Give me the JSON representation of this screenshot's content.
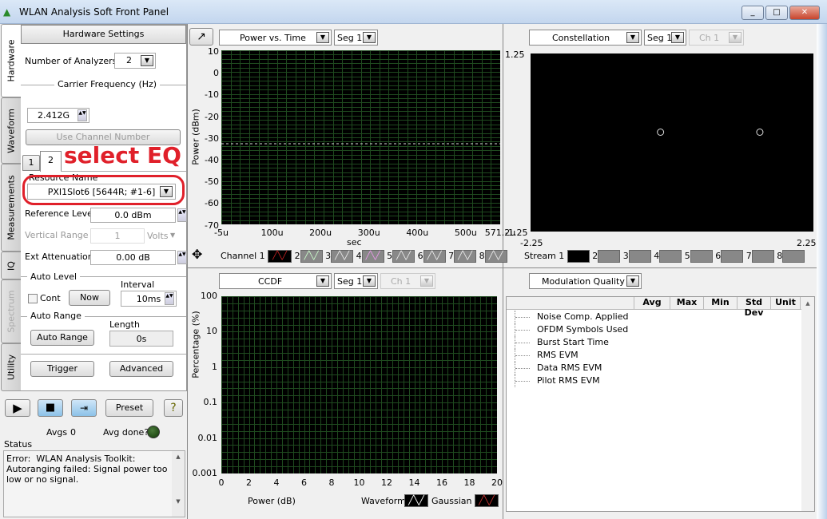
{
  "window": {
    "title": "WLAN Analysis Soft Front Panel",
    "buttons": [
      "_",
      "□",
      "✕"
    ]
  },
  "tabs": [
    {
      "label": "Hardware",
      "selected": true
    },
    {
      "label": "Waveform"
    },
    {
      "label": "Measurements"
    },
    {
      "label": "IQ"
    },
    {
      "label": "Spectrum",
      "disabled": true
    },
    {
      "label": "Utility"
    }
  ],
  "hardware": {
    "header": "Hardware Settings",
    "num_analyzers_label": "Number of Analyzers",
    "num_analyzers": "2",
    "carrier_label": "Carrier Frequency (Hz)",
    "carrier": "2.412G",
    "use_channel": "Use Channel Number",
    "subtabs": [
      "1",
      "2"
    ],
    "annotation": "select EQ",
    "resource_label": "Resource Name",
    "resource": "PXI1Slot6 [5644R; #1-6]",
    "ref_level_label": "Reference Level",
    "ref_level": "0.0 dBm",
    "vert_range_label": "Vertical Range",
    "vert_range": "1",
    "vert_unit": "Volts",
    "ext_att_label": "Ext Attenuation",
    "ext_att": "0.00 dB",
    "auto_level": "Auto Level",
    "interval_label": "Interval",
    "cont": "Cont",
    "now": "Now",
    "interval": "10ms",
    "auto_range_section": "Auto Range",
    "length_label": "Length",
    "auto_range_btn": "Auto Range",
    "length": "0s",
    "trigger": "Trigger",
    "advanced": "Advanced"
  },
  "controls": {
    "preset": "Preset",
    "help": "?",
    "avgs_label": "Avgs",
    "avgs": "0",
    "avg_done": "Avg done?",
    "status_label": "Status",
    "status": "Error:  WLAN Analysis Toolkit:\nAutoranging failed: Signal power too low or no signal."
  },
  "colors": {
    "annotation": "#e0202a",
    "grid": "#1f4a1f",
    "led": "#1f4a12"
  },
  "pvt": {
    "select": "Power vs. Time",
    "seg": "Seg 1",
    "ylabel": "Power (dBm)",
    "xlabel": "sec",
    "yticks": [
      "10",
      "0",
      "-10",
      "-20",
      "-30",
      "-40",
      "-50",
      "-60",
      "-70"
    ],
    "xticks": [
      "-5u",
      "100u",
      "200u",
      "300u",
      "400u",
      "500u",
      "571.2u"
    ],
    "legend_label": "Channel 1",
    "legend_nums": [
      "2",
      "3",
      "4",
      "5",
      "6",
      "7",
      "8"
    ],
    "ref_line_dbm": -33
  },
  "constellation": {
    "select": "Constellation",
    "seg": "Seg 1",
    "ch": "Ch 1",
    "ymax": "1.25",
    "ymin": "-1.25",
    "xmin": "-2.25",
    "xmax": "2.25",
    "points": [
      [
        -0.03,
        0
      ],
      [
        1.55,
        0
      ]
    ],
    "legend_label": "Stream 1",
    "legend_nums": [
      "2",
      "3",
      "4",
      "5",
      "6",
      "7",
      "8"
    ]
  },
  "ccdf": {
    "select": "CCDF",
    "seg": "Seg 1",
    "ch": "Ch 1",
    "ylabel": "Percentage (%)",
    "xlabel": "Power (dB)",
    "yticks": [
      "100",
      "10",
      "1",
      "0.1",
      "0.01",
      "0.001"
    ],
    "xticks": [
      "0",
      "2",
      "4",
      "6",
      "8",
      "10",
      "12",
      "14",
      "16",
      "18",
      "20"
    ],
    "legend": [
      "Waveform",
      "Gaussian"
    ]
  },
  "modq": {
    "select": "Modulation Quality",
    "columns": [
      "",
      "Avg",
      "Max",
      "Min",
      "Std Dev",
      "Unit"
    ],
    "rows": [
      "Noise Comp. Applied",
      "OFDM Symbols Used",
      "Burst Start Time",
      "RMS EVM",
      "Data RMS EVM",
      "Pilot RMS EVM"
    ]
  }
}
